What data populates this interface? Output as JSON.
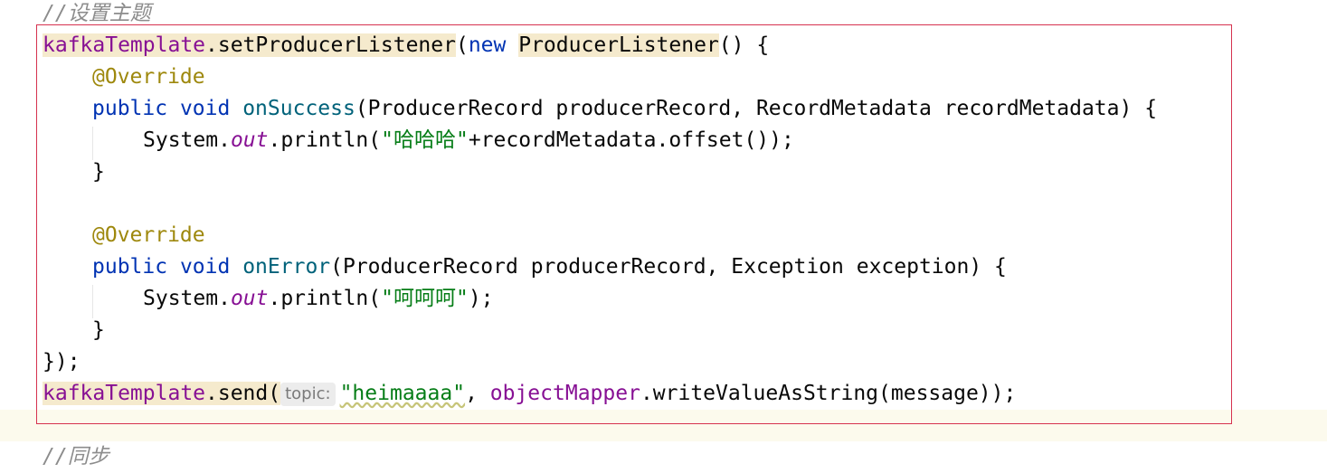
{
  "editor": {
    "comment_top": "//设置主题",
    "comment_bottom": "//同步",
    "l1": {
      "obj": "kafkaTemplate",
      "dot_method": ".setProducerListener",
      "paren": "(",
      "kw_new": "new",
      "sp": " ",
      "class": "ProducerListener",
      "rest": "() {"
    },
    "l2": {
      "anno": "@Override"
    },
    "l3": {
      "kw_public": "public",
      "kw_void": "void",
      "method": "onSuccess",
      "rest": "(ProducerRecord producerRecord, RecordMetadata recordMetadata) {"
    },
    "l4": {
      "sys": "System.",
      "out": "out",
      "println": ".println(",
      "str": "\"哈哈哈\"",
      "rest": "+recordMetadata.offset());"
    },
    "l5": {
      "brace": "}"
    },
    "l6": {
      "anno": "@Override"
    },
    "l7": {
      "kw_public": "public",
      "kw_void": "void",
      "method": "onError",
      "rest": "(ProducerRecord producerRecord, Exception exception) {"
    },
    "l8": {
      "sys": "System.",
      "out": "out",
      "println": ".println(",
      "str": "\"呵呵呵\"",
      "rest": ");"
    },
    "l9": {
      "brace": "}"
    },
    "l10": {
      "text": "});"
    },
    "l11": {
      "obj": "kafkaTemplate",
      "dot_method": ".send(",
      "hint": "topic:",
      "str": "\"heimaaaa\"",
      "comma": ", ",
      "field2": "objectMapper",
      "rest": ".writeValueAsString(message));"
    }
  }
}
